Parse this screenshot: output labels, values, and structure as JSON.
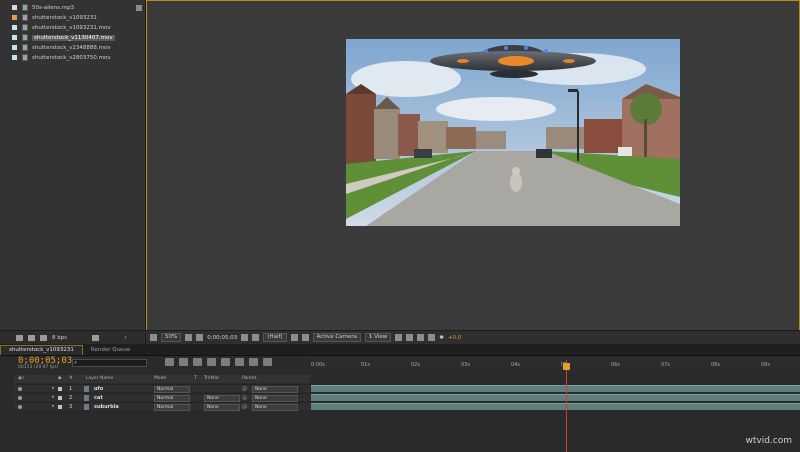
{
  "project": {
    "items": [
      {
        "name": "50s-aliens.mp3",
        "color": "#d8d8d8",
        "selected": false
      },
      {
        "name": "shutterstock_v1093231",
        "color": "#e0a04a",
        "selected": false
      },
      {
        "name": "shutterstock_v1093231.mov",
        "color": "#c9e4e8",
        "selected": false
      },
      {
        "name": "shutterstock_v1130407.mov",
        "color": "#c9e4e8",
        "selected": true
      },
      {
        "name": "shutterstock_v2348888.mov",
        "color": "#c9e4e8",
        "selected": false
      },
      {
        "name": "shutterstock_v2803750.mov",
        "color": "#c9e4e8",
        "selected": false
      }
    ],
    "bpc_label": "8 bpc"
  },
  "viewer": {
    "zoom": "50%",
    "timecode": "0;00;05;03",
    "resolution": "(Half)",
    "camera": "Active Camera",
    "view": "1 View",
    "exposure": "+0.0"
  },
  "timeline": {
    "tabs": [
      "shutterstock_v1093231",
      "Render Queue"
    ],
    "timecode": "0;00;05;03",
    "frames_info": "00153 (29.97 fps)",
    "search_icon": "search-icon",
    "columns": {
      "num": "#",
      "layer_name": "Layer Name",
      "mode": "Mode",
      "t": "T",
      "trkmat": "TrkMat",
      "parent": "Parent"
    },
    "layers": [
      {
        "num": "1",
        "name": "ufo",
        "mode": "Normal",
        "trkmat": "",
        "parent": "None",
        "color": "#b9c6d6"
      },
      {
        "num": "2",
        "name": "cat",
        "mode": "Normal",
        "trkmat": "None",
        "parent": "None",
        "color": "#b9c6d6"
      },
      {
        "num": "3",
        "name": "suburbia",
        "mode": "Normal",
        "trkmat": "None",
        "parent": "None",
        "color": "#b9c6d6"
      }
    ],
    "ruler_ticks": [
      "0:00s",
      "01s",
      "02s",
      "03s",
      "04s",
      "05s",
      "06s",
      "07s",
      "08s",
      "09s"
    ],
    "playhead_seconds": 5.1
  },
  "watermark": "wtvid.com"
}
